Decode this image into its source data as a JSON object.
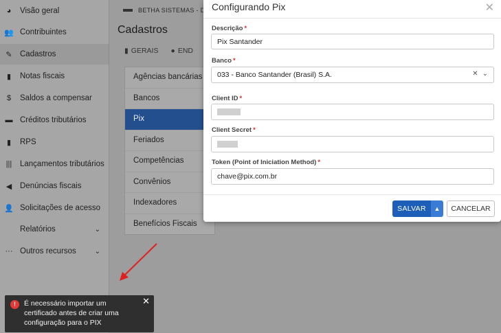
{
  "sidebar": {
    "items": [
      {
        "label": "Visão geral",
        "icon": "pie-chart-icon"
      },
      {
        "label": "Contribuintes",
        "icon": "users-icon"
      },
      {
        "label": "Cadastros",
        "icon": "edit-icon"
      },
      {
        "label": "Notas fiscais",
        "icon": "file-icon"
      },
      {
        "label": "Saldos a compensar",
        "icon": "dollar-icon"
      },
      {
        "label": "Créditos tributários",
        "icon": "card-icon"
      },
      {
        "label": "RPS",
        "icon": "document-icon"
      },
      {
        "label": "Lançamentos tributários",
        "icon": "barcode-icon"
      },
      {
        "label": "Denúncias fiscais",
        "icon": "megaphone-icon"
      },
      {
        "label": "Solicitações de acesso",
        "icon": "user-plus-icon"
      },
      {
        "label": "Relatórios",
        "icon": ""
      },
      {
        "label": "Outros recursos",
        "icon": "ellipsis-icon"
      }
    ]
  },
  "header": {
    "org": "BETHA SISTEMAS - DIP"
  },
  "page": {
    "title": "Cadastros"
  },
  "tabs": {
    "geral": "GERAIS",
    "end": "END"
  },
  "menu": [
    "Agências bancárias",
    "Bancos",
    "Pix",
    "Feriados",
    "Competências",
    "Convênios",
    "Indexadores",
    "Benefícios Fiscais"
  ],
  "modal": {
    "title": "Configurando Pix",
    "descricao_label": "Descrição",
    "descricao_value": "Pix Santander",
    "banco_label": "Banco",
    "banco_value": "033 - Banco Santander (Brasil) S.A.",
    "client_id_label": "Client ID",
    "client_secret_label": "Client Secret",
    "token_label": "Token (Point of Iniciation Method)",
    "token_value": "chave@pix.com.br",
    "save_label": "SALVAR",
    "cancel_label": "CANCELAR"
  },
  "toast": {
    "message": "É necessário importar um certificado antes de criar uma configuração para o PIX"
  },
  "colors": {
    "primary": "#1d5fb8",
    "active_menu": "#244f8e",
    "error": "#e53935"
  }
}
